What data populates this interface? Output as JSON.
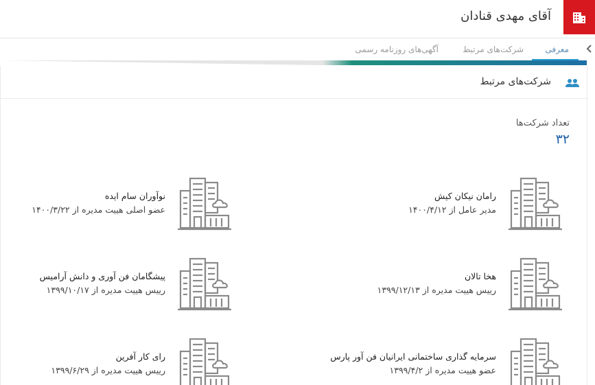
{
  "header": {
    "title": "آقای مهدی قنادان",
    "logo_icon": "building-icon",
    "accent": "#d7191f"
  },
  "tabs": [
    {
      "label": "معرفی",
      "active": true
    },
    {
      "label": "شرکت‌های مرتبط",
      "active": false
    },
    {
      "label": "آگهی‌های روزنامه رسمی",
      "active": false
    }
  ],
  "section": {
    "title": "شرکت‌های مرتبط",
    "icon": "people-icon"
  },
  "count": {
    "label": "تعداد شرکت‌ها",
    "value": "۳۲"
  },
  "companies": [
    {
      "name": "رامان نیکان کیش",
      "role": "مدیر عامل از ۱۴۰۰/۴/۱۲"
    },
    {
      "name": "نوآوران سام ایده",
      "role": "عضو اصلی هییت مدیره از ۱۴۰۰/۳/۲۲"
    },
    {
      "name": "هخا تالان",
      "role": "رییس هییت مدیره از ۱۳۹۹/۱۲/۱۳"
    },
    {
      "name": "پیشگامان فن آوری و دانش آرامیس",
      "role": "رییس هییت مدیره از ۱۳۹۹/۱۰/۱۷"
    },
    {
      "name": "سرمایه گذاری ساختمانی ایرانیان فن آور پارس",
      "role": "عضو هییت مدیره از ۱۳۹۹/۴/۲"
    },
    {
      "name": "رای کار آفرین",
      "role": "رییس هییت مدیره از ۱۳۹۹/۶/۲۹"
    }
  ]
}
